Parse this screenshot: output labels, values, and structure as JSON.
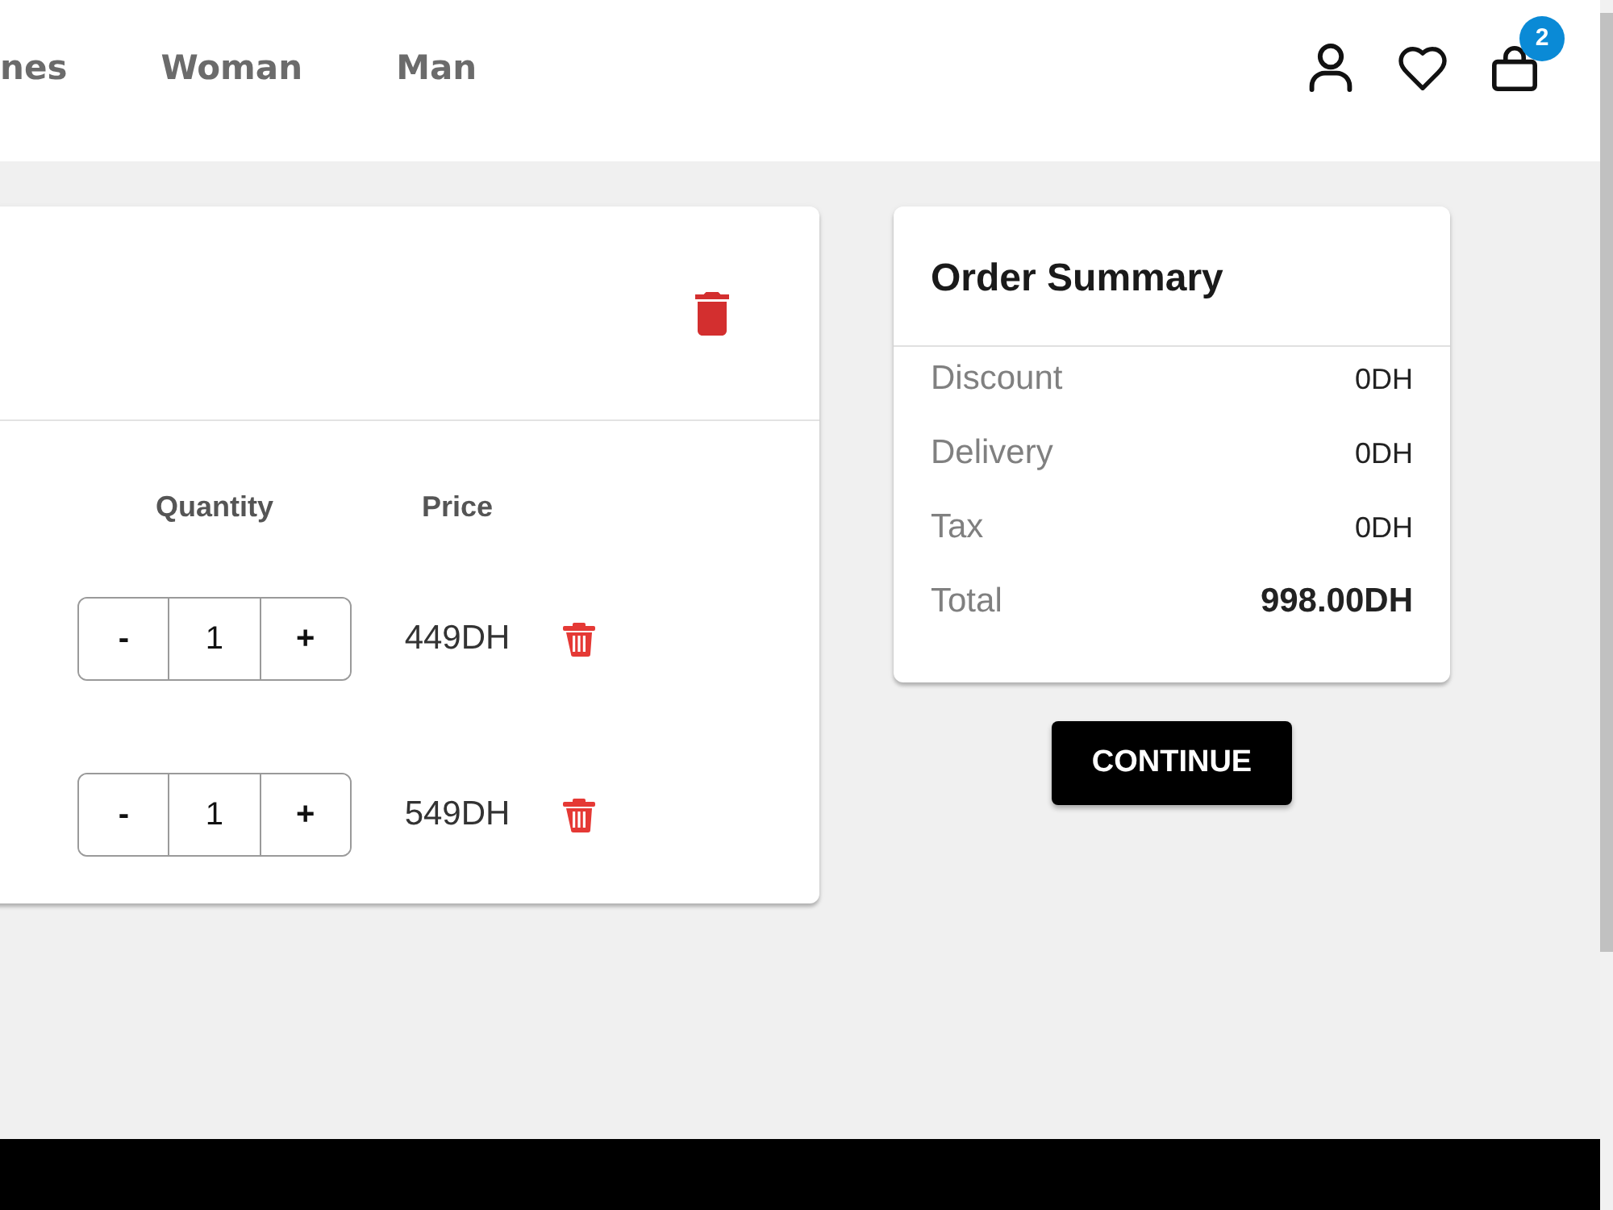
{
  "nav": {
    "links": [
      {
        "label": "nes"
      },
      {
        "label": "Woman"
      },
      {
        "label": "Man"
      }
    ],
    "cart_count": "2"
  },
  "cart": {
    "columns": [
      "Quantity",
      "Price"
    ],
    "items": [
      {
        "decrement": "-",
        "quantity": "1",
        "increment": "+",
        "price": "449DH"
      },
      {
        "decrement": "-",
        "quantity": "1",
        "increment": "+",
        "price": "549DH"
      }
    ]
  },
  "summary": {
    "title": "Order Summary",
    "rows": [
      {
        "kind": "normal",
        "label": "Discount",
        "value": "0DH"
      },
      {
        "kind": "normal",
        "label": "Delivery",
        "value": "0DH"
      },
      {
        "kind": "normal",
        "label": "Tax",
        "value": "0DH"
      },
      {
        "kind": "total",
        "label": "Total",
        "value": "998.00DH"
      }
    ]
  },
  "continue_button": "CONTINUE"
}
